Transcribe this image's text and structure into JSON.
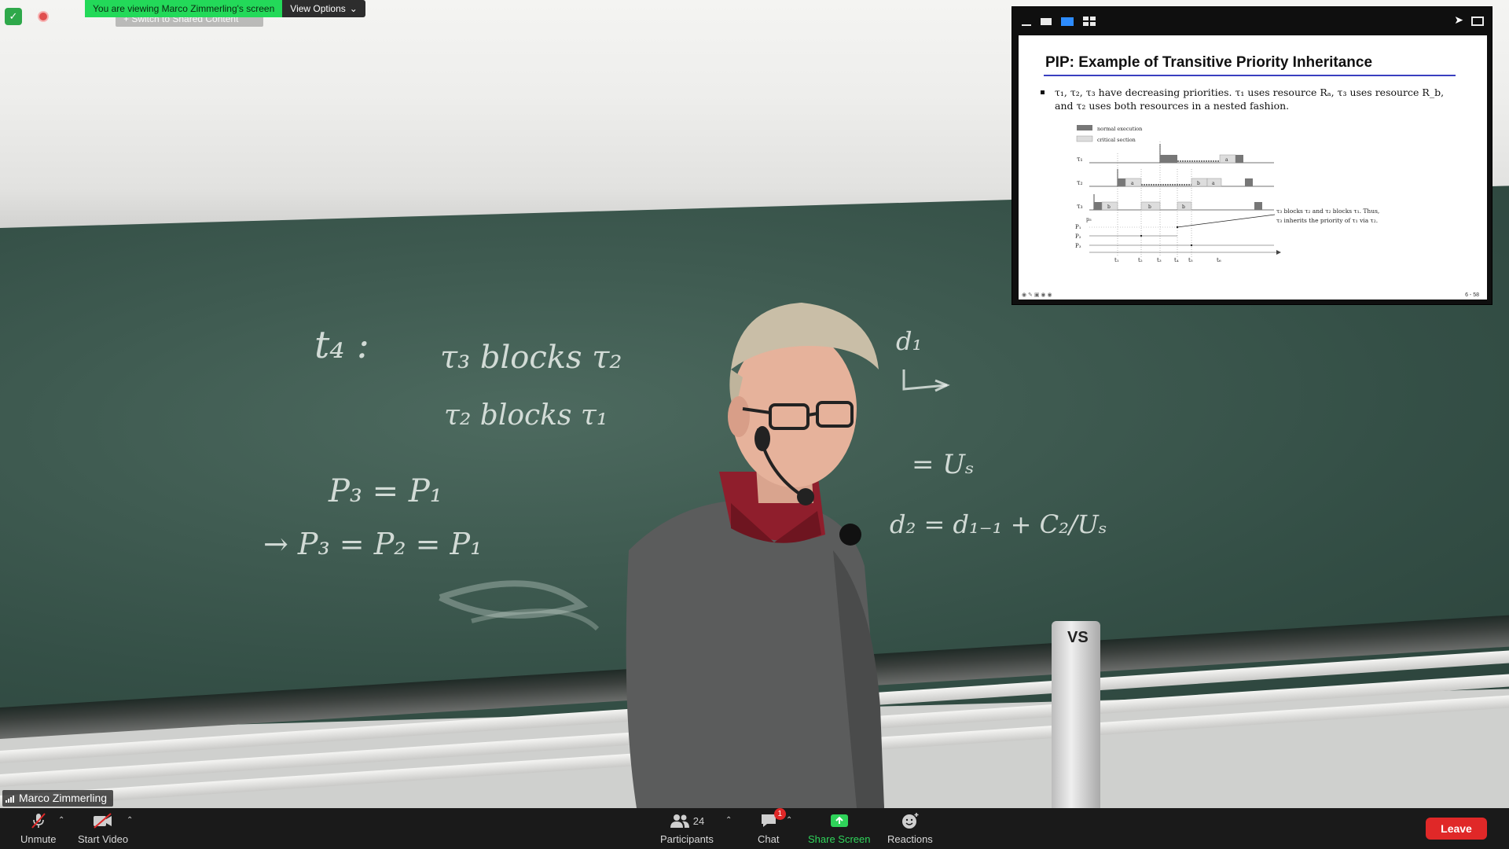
{
  "banner": {
    "viewing_text": "You are viewing Marco Zimmerling's screen",
    "view_options_label": "View Options",
    "ghost_button_label": "+ Switch to Shared Content"
  },
  "share_toolbar": {
    "icons": [
      "minimize-icon",
      "single-view-icon",
      "speaker-view-icon",
      "gallery-view-icon",
      "exit-fullscreen-icon"
    ]
  },
  "slide": {
    "title": "PIP: Example of Transitive Priority Inheritance",
    "bullet_line1": "τ₁, τ₂, τ₃ have decreasing priorities. τ₁ uses resource Rₐ, τ₃ uses resource R_b,",
    "bullet_line2": "and τ₂ uses both resources in a nested fashion.",
    "legend_normal": "normal execution",
    "legend_critical": "critical section",
    "task_labels": [
      "τ₁",
      "τ₂",
      "τ₃"
    ],
    "priority_labels": [
      "p₃",
      "P₁",
      "P₂",
      "P₃"
    ],
    "time_labels": [
      "t₁",
      "t₂",
      "t₃",
      "t₄",
      "t₅",
      "t₆"
    ],
    "block_labels": [
      "a",
      "a",
      "b",
      "a",
      "b",
      "b",
      "b",
      "b"
    ],
    "annotation_line1": "τ₃ blocks τ₂ and τ₂ blocks τ₁. Thus,",
    "annotation_line2": "τ₃ inherits the priority of τ₁ via τ₂.",
    "page_number": "6 - 58"
  },
  "chalkboard": {
    "lines": [
      "t₄ :",
      "τ₃ blocks τ₂",
      "τ₂ blocks τ₁",
      "P₃ = P₁",
      "→  P₃ = P₂ = P₁",
      "d₁",
      "= Uₛ",
      "d₂ = d₁₋₁ + C₂/Uₛ"
    ]
  },
  "post_label": "VS",
  "participant": {
    "name": "Marco Zimmerling"
  },
  "controls": {
    "unmute_label": "Unmute",
    "start_video_label": "Start Video",
    "participants_label": "Participants",
    "participants_count": "24",
    "chat_label": "Chat",
    "chat_badge": "1",
    "share_screen_label": "Share Screen",
    "reactions_label": "Reactions",
    "leave_label": "Leave"
  },
  "colors": {
    "green_banner": "#23d959",
    "share_green": "#2fd35a",
    "leave_red": "#e02828",
    "active_blue": "#2d8cff",
    "slide_rule": "#3a3fc0"
  }
}
